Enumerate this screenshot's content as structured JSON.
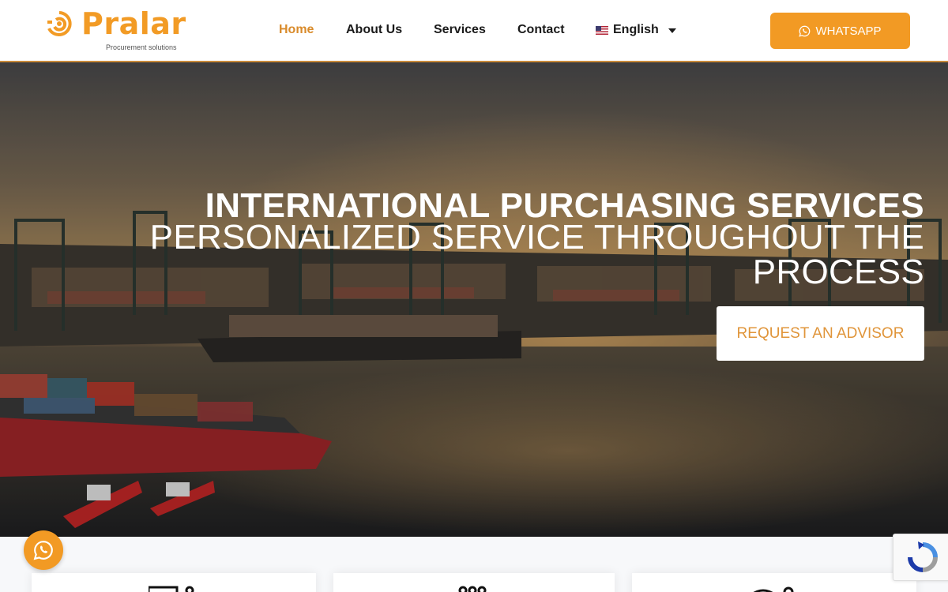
{
  "brand": {
    "name": "Pralar",
    "tagline": "Procurement solutions",
    "color": "#f29b25"
  },
  "nav": {
    "items": [
      {
        "label": "Home",
        "active": true
      },
      {
        "label": "About Us",
        "active": false
      },
      {
        "label": "Services",
        "active": false
      },
      {
        "label": "Contact",
        "active": false
      }
    ],
    "language": "English"
  },
  "header_cta": {
    "label": "WHATSAPP",
    "icon": "whatsapp-icon",
    "color": "#f29a24"
  },
  "hero": {
    "title": "INTERNATIONAL PURCHASING SERVICES",
    "subtitle": "PERSONALIZED SERVICE THROUGHOUT THE PROCESS",
    "button": "REQUEST AN ADVISOR"
  },
  "floating": {
    "whatsapp_icon": "whatsapp-icon",
    "recaptcha_icon": "recaptcha-icon"
  }
}
